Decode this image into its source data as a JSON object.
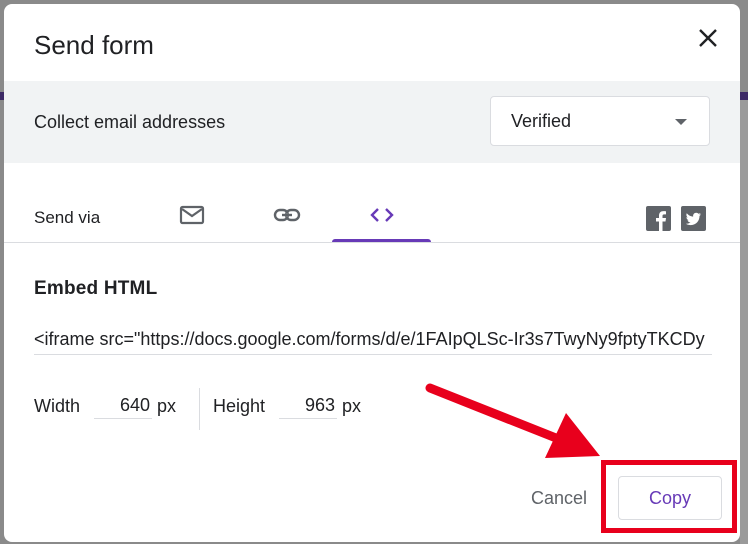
{
  "dialog": {
    "title": "Send form",
    "close_icon": "close-icon"
  },
  "collect_email": {
    "label": "Collect email addresses",
    "selected": "Verified"
  },
  "send_via": {
    "label": "Send via",
    "tabs": [
      {
        "icon": "email-icon",
        "active": false
      },
      {
        "icon": "link-icon",
        "active": false
      },
      {
        "icon": "embed-code-icon",
        "active": true
      }
    ],
    "social": [
      {
        "icon": "facebook-icon"
      },
      {
        "icon": "twitter-icon"
      }
    ]
  },
  "embed": {
    "heading": "Embed HTML",
    "code": "<iframe src=\"https://docs.google.com/forms/d/e/1FAIpQLSc-Ir3s7TwyNy9fptyTKCDy",
    "width_label": "Width",
    "width_value": "640",
    "height_label": "Height",
    "height_value": "963",
    "unit": "px"
  },
  "footer": {
    "cancel_label": "Cancel",
    "copy_label": "Copy"
  },
  "colors": {
    "accent": "#673ab7",
    "annotation_red": "#e8001c"
  }
}
